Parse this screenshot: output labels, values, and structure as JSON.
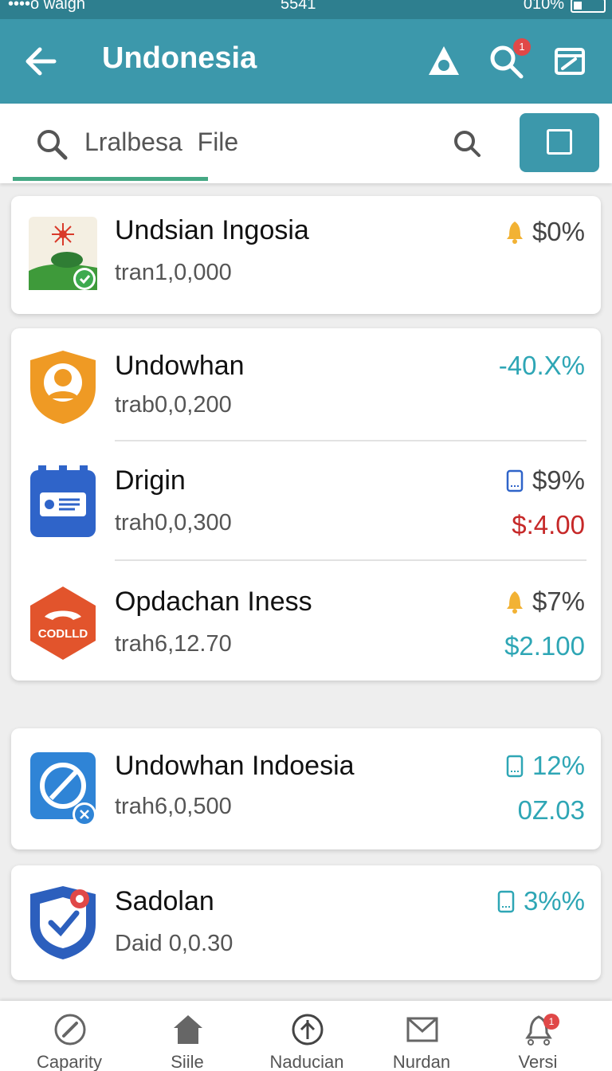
{
  "status_bar": {
    "carrier": "••••o waigh",
    "time": "5541",
    "battery": "010%"
  },
  "app_bar": {
    "title": "Undonesia",
    "notification_count": "1"
  },
  "search": {
    "placeholder": "Lralbesa  File"
  },
  "cards": [
    {
      "items": [
        {
          "name": "Undsian Ingosia",
          "sub": "tran1,0,000",
          "pct": "$0%",
          "pct_icon": "bell-icon",
          "value": ""
        }
      ]
    },
    {
      "items": [
        {
          "name": "Undowhan",
          "sub": "trab0,0,200",
          "pct": "-40.X%",
          "pct_icon": "",
          "value": ""
        },
        {
          "name": "Drigin",
          "sub": "trah0,0,300",
          "pct": "$9%",
          "pct_icon": "battery-icon",
          "value": "$:4.00"
        },
        {
          "name": "Opdachan Iness",
          "sub": "trah6,12.70",
          "pct": "$7%",
          "pct_icon": "bell-icon",
          "value": "$2.100"
        }
      ]
    },
    {
      "items": [
        {
          "name": "Undowhan Indoesia",
          "sub": "trah6,0,500",
          "pct": "12%",
          "pct_icon": "battery-icon",
          "value": "0Z.03"
        }
      ]
    },
    {
      "items": [
        {
          "name": "Sadolan",
          "sub": "Daid 0,0.30",
          "pct": "3%%",
          "pct_icon": "battery-icon",
          "value": ""
        }
      ]
    }
  ],
  "logo_text": "CODLLD",
  "bottom_nav": [
    {
      "label": "Caparity",
      "icon": "gauge-icon"
    },
    {
      "label": "Siile",
      "icon": "home-icon"
    },
    {
      "label": "Naducian",
      "icon": "compass-icon"
    },
    {
      "label": "Nurdan",
      "icon": "mail-icon"
    },
    {
      "label": "Versi",
      "icon": "bell-outline-icon",
      "badge": "1"
    }
  ],
  "colors": {
    "header": "#3c98ab",
    "accent_green": "#45a884",
    "teal_value": "#2ea6b5",
    "red_value": "#c62828"
  }
}
